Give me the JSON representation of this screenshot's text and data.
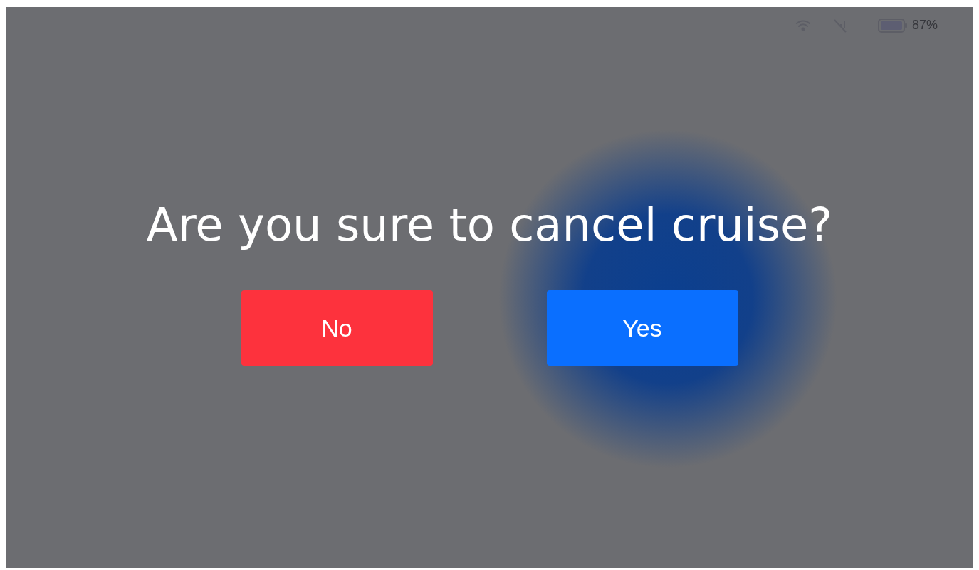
{
  "status_bar": {
    "battery_text": "87%"
  },
  "dialog": {
    "title": "Are you sure to cancel cruise?",
    "buttons": [
      {
        "label": "No",
        "kind": "cancel"
      },
      {
        "label": "Yes",
        "kind": "confirm"
      }
    ]
  }
}
